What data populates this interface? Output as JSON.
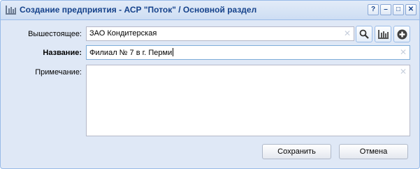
{
  "window": {
    "title": "Создание предприятия - АСР \"Поток\" / Основной раздел",
    "buttons": [
      "?",
      "–",
      "□",
      "✕"
    ]
  },
  "form": {
    "parent": {
      "label": "Вышестоящее:",
      "value": "ЗАО Кондитерская"
    },
    "name": {
      "label": "Название:",
      "value": "Филиал № 7 в г. Перми"
    },
    "note": {
      "label": "Примечание:",
      "value": ""
    }
  },
  "actions": {
    "save": "Сохранить",
    "cancel": "Отмена"
  },
  "colors": {
    "titleText": "#15428b",
    "frame": "#99bbe8",
    "background": "#dfe8f6"
  },
  "icons": [
    "window-icon",
    "search-icon",
    "hierarchy-icon",
    "add-icon",
    "clear-icon"
  ]
}
